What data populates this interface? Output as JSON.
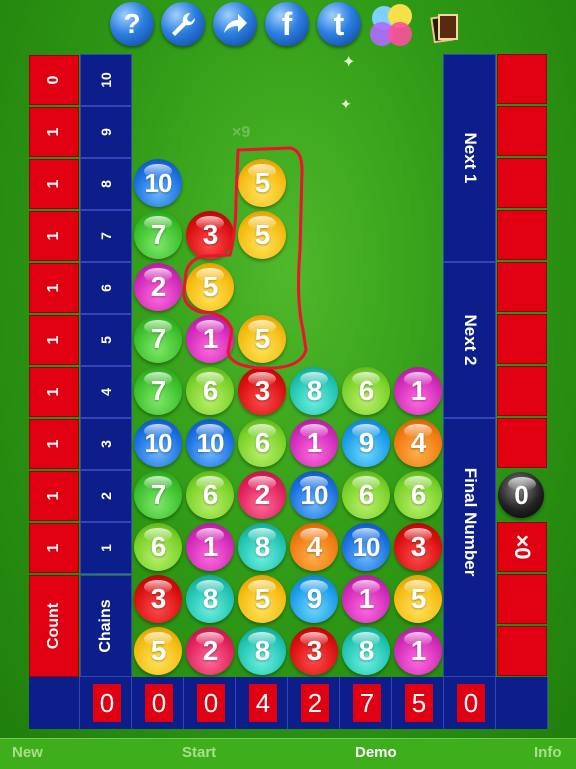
{
  "toolbar": {
    "icons": [
      "help-icon",
      "wrench-icon",
      "share-arrow-icon",
      "facebook-icon",
      "twitter-icon",
      "game-center-icon",
      "cards-icon"
    ],
    "help_glyph": "?",
    "facebook_glyph": "f",
    "twitter_glyph": "t"
  },
  "left_columns": {
    "count_values": [
      "0",
      "1",
      "1",
      "1",
      "1",
      "1",
      "1",
      "1",
      "1",
      "1"
    ],
    "count_label": "Count",
    "chains_values": [
      "10",
      "9",
      "8",
      "7",
      "6",
      "5",
      "4",
      "3",
      "2",
      "1"
    ],
    "chains_label": "Chains"
  },
  "right_panel": {
    "next1_label": "Next 1",
    "next2_label": "Next 2",
    "final_label": "Final Number",
    "final_ball": "0",
    "multiplier": "×0"
  },
  "board_watermark": "×9",
  "board": [
    [
      "10",
      "",
      "5",
      "",
      "",
      ""
    ],
    [
      "7",
      "3",
      "5",
      "",
      "",
      ""
    ],
    [
      "2",
      "5",
      "",
      "",
      "",
      ""
    ],
    [
      "7",
      "1",
      "5",
      "",
      "",
      ""
    ],
    [
      "7",
      "6",
      "3",
      "8",
      "6",
      "1"
    ],
    [
      "10",
      "10",
      "6",
      "1",
      "9",
      "4"
    ],
    [
      "7",
      "6",
      "2",
      "10",
      "6",
      "6"
    ],
    [
      "6",
      "1",
      "8",
      "4",
      "10",
      "3"
    ],
    [
      "3",
      "8",
      "5",
      "9",
      "1",
      "5"
    ],
    [
      "5",
      "2",
      "8",
      "3",
      "8",
      "1"
    ]
  ],
  "board_colors": [
    [
      "c10",
      "",
      "c5",
      "",
      "",
      ""
    ],
    [
      "c7",
      "c3",
      "c5",
      "",
      "",
      ""
    ],
    [
      "c1",
      "c5",
      "",
      "",
      "",
      ""
    ],
    [
      "c7",
      "c1",
      "c5",
      "",
      "",
      ""
    ],
    [
      "c7",
      "c6",
      "c3",
      "c8",
      "c6",
      "c1"
    ],
    [
      "c10",
      "c10",
      "c6",
      "c1",
      "c9",
      "c4"
    ],
    [
      "c7",
      "c6",
      "c2",
      "c10",
      "c6",
      "c6"
    ],
    [
      "c6",
      "c1",
      "c8",
      "c4",
      "c10",
      "c3"
    ],
    [
      "c3",
      "c8",
      "c5",
      "c9",
      "c1",
      "c5"
    ],
    [
      "c5",
      "c2",
      "c8",
      "c3",
      "c8",
      "c1"
    ]
  ],
  "bottom_digits": [
    "0",
    "0",
    "0",
    "4",
    "2",
    "7",
    "5",
    "0"
  ],
  "menu": {
    "new": "New",
    "start": "Start",
    "demo": "Demo",
    "info": "Info"
  },
  "colors": {
    "red": "#e00012",
    "navy": "#0c1e8a",
    "menu_active": "#ffffff",
    "menu_inactive": "#a8e08a"
  }
}
